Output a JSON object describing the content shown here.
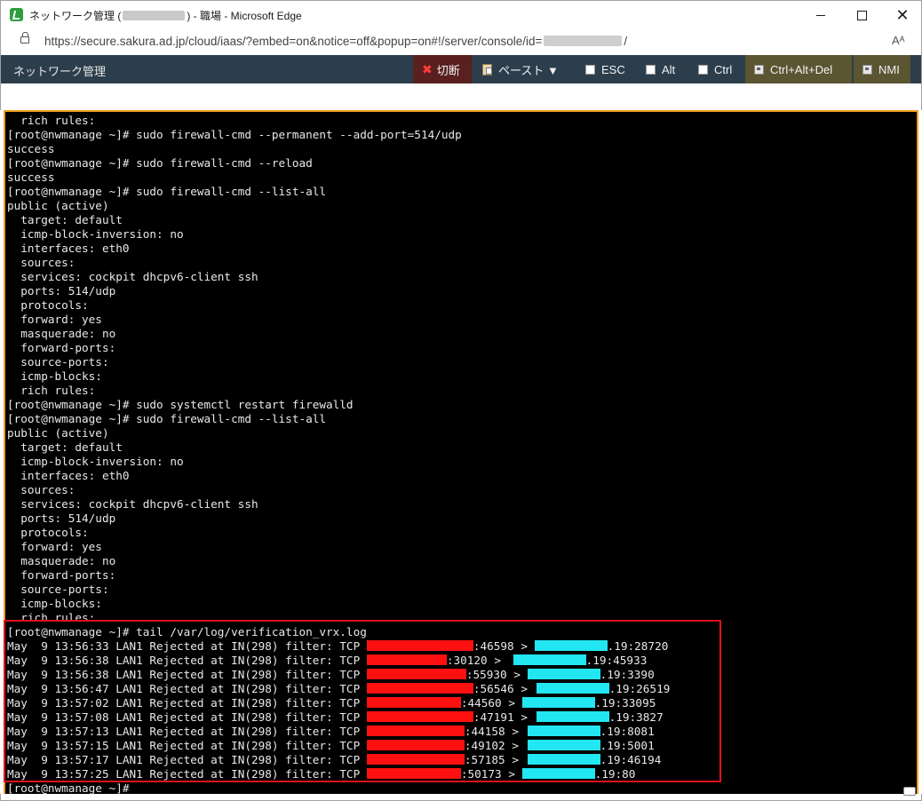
{
  "window": {
    "title_prefix": "ネットワーク管理 (",
    "title_suffix": ") - 職場 - Microsoft Edge",
    "min_glyph": "",
    "max_glyph": "",
    "close_glyph": "✕"
  },
  "address_bar": {
    "url_prefix": "https://secure.sakura.ad.jp/cloud/iaas/?embed=on&notice=off&popup=on#!/server/console/id=",
    "url_suffix": "/",
    "read_aloud_glyph": "Aᴬ"
  },
  "toolbar": {
    "app_title": "ネットワーク管理",
    "disconnect_label": "切断",
    "paste_label": "ペースト ▼",
    "esc_label": "ESC",
    "alt_label": "Alt",
    "ctrl_label": "Ctrl",
    "cad_label": "Ctrl+Alt+Del",
    "nmi_label": "NMI",
    "colors": {
      "background": "#2c3e4c",
      "disconnect_bg": "#5a1f1f",
      "key_bg": "#5b5532"
    }
  },
  "terminal": {
    "colors": {
      "background": "#000000",
      "text": "#e8e8e8",
      "border": "#f0a020",
      "highlight": "#e0111a"
    },
    "lines": [
      "  rich rules:",
      "[root@nwmanage ~]# sudo firewall-cmd --permanent --add-port=514/udp",
      "success",
      "[root@nwmanage ~]# sudo firewall-cmd --reload",
      "success",
      "[root@nwmanage ~]# sudo firewall-cmd --list-all",
      "public (active)",
      "  target: default",
      "  icmp-block-inversion: no",
      "  interfaces: eth0",
      "  sources:",
      "  services: cockpit dhcpv6-client ssh",
      "  ports: 514/udp",
      "  protocols:",
      "  forward: yes",
      "  masquerade: no",
      "  forward-ports:",
      "  source-ports:",
      "  icmp-blocks:",
      "  rich rules:",
      "[root@nwmanage ~]# sudo systemctl restart firewalld",
      "[root@nwmanage ~]# sudo firewall-cmd --list-all",
      "public (active)",
      "  target: default",
      "  icmp-block-inversion: no",
      "  interfaces: eth0",
      "  sources:",
      "  services: cockpit dhcpv6-client ssh",
      "  ports: 514/udp",
      "  protocols:",
      "  forward: yes",
      "  masquerade: no",
      "  forward-ports:",
      "  source-ports:",
      "  icmp-blocks:",
      "  rich rules:",
      "[root@nwmanage ~]# tail /var/log/verification_vrx.log"
    ],
    "log_entries": [
      {
        "prefix": "May  9 13:56:33 LAN1 Rejected at IN(298) filter: TCP ",
        "src_port": ":46598 > ",
        "dst": ".19:28720"
      },
      {
        "prefix": "May  9 13:56:38 LAN1 Rejected at IN(298) filter: TCP ",
        "src_port": ":30120 > ",
        "dst": ".19:45933"
      },
      {
        "prefix": "May  9 13:56:38 LAN1 Rejected at IN(298) filter: TCP ",
        "src_port": ":55930 > ",
        "dst": ".19:3390"
      },
      {
        "prefix": "May  9 13:56:47 LAN1 Rejected at IN(298) filter: TCP ",
        "src_port": ":56546 > ",
        "dst": ".19:26519"
      },
      {
        "prefix": "May  9 13:57:02 LAN1 Rejected at IN(298) filter: TCP ",
        "src_port": ":44560 > ",
        "dst": ".19:33095"
      },
      {
        "prefix": "May  9 13:57:08 LAN1 Rejected at IN(298) filter: TCP ",
        "src_port": ":47191 > ",
        "dst": ".19:3827"
      },
      {
        "prefix": "May  9 13:57:13 LAN1 Rejected at IN(298) filter: TCP ",
        "src_port": ":44158 > ",
        "dst": ".19:8081"
      },
      {
        "prefix": "May  9 13:57:15 LAN1 Rejected at IN(298) filter: TCP ",
        "src_port": ":49102 > ",
        "dst": ".19:5001"
      },
      {
        "prefix": "May  9 13:57:17 LAN1 Rejected at IN(298) filter: TCP ",
        "src_port": ":57185 > ",
        "dst": ".19:46194"
      },
      {
        "prefix": "May  9 13:57:25 LAN1 Rejected at IN(298) filter: TCP ",
        "src_port": ":50173 > ",
        "dst": ".19:80"
      }
    ],
    "final_prompt": "[root@nwmanage ~]# "
  }
}
